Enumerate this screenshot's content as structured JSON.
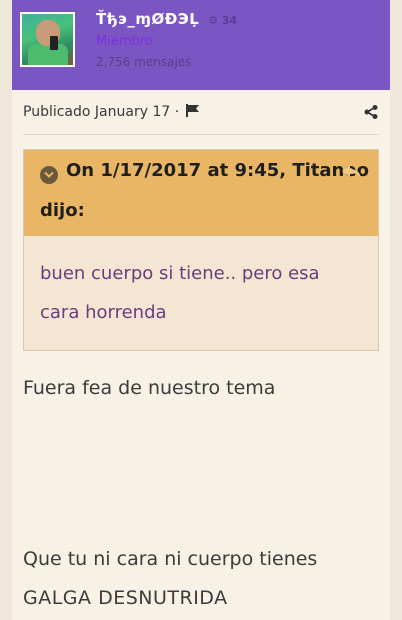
{
  "author": {
    "name": "Ťђэ_ɱØĐЭĻ",
    "badges": "⚙ 34",
    "role": "Miembro",
    "posts": "2,756 mensajes"
  },
  "post": {
    "published": "Publicado January 17 ·"
  },
  "quote": {
    "title_line1": "On 1/17/2017 at 9:45, Titaneo",
    "title_line2": "dijo:",
    "body": "buen cuerpo si tiene.. pero esa cara horrenda"
  },
  "content": {
    "line1": "Fuera fea de nuestro tema",
    "line2": "Que tu ni cara ni cuerpo tienes",
    "line3": "GALGA DESNUTRIDA"
  },
  "icons": {
    "flag": "flag-icon",
    "share": "share-icon",
    "chevron": "chevron-down-icon",
    "reply": "reply-icon"
  },
  "colors": {
    "header_bg": "#7b55c2",
    "quote_head_bg": "#e8b665",
    "quote_body_bg": "#f5e6d3",
    "quote_text": "#6b3c7e",
    "role_text": "#7a2fe6"
  }
}
